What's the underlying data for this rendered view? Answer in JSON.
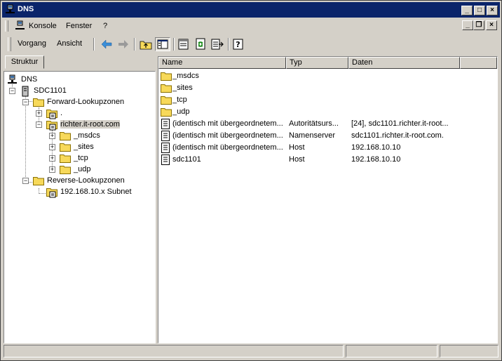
{
  "window": {
    "title": "DNS"
  },
  "menu": {
    "items": [
      "Konsole",
      "Fenster",
      "?"
    ]
  },
  "action_menu": {
    "items": [
      "Vorgang",
      "Ansicht"
    ]
  },
  "tab": {
    "label": "Struktur"
  },
  "tree": {
    "root": "DNS",
    "server": "SDC1101",
    "forward": "Forward-Lookupzonen",
    "dot_zone": ".",
    "zone": "richter.it-root.com",
    "children": [
      "_msdcs",
      "_sites",
      "_tcp",
      "_udp"
    ],
    "reverse": "Reverse-Lookupzonen",
    "subnet": "192.168.10.x Subnet"
  },
  "list": {
    "columns": [
      "Name",
      "Typ",
      "Daten"
    ],
    "rows": [
      {
        "icon": "folder",
        "name": "_msdcs",
        "type": "",
        "data": ""
      },
      {
        "icon": "folder",
        "name": "_sites",
        "type": "",
        "data": ""
      },
      {
        "icon": "folder",
        "name": "_tcp",
        "type": "",
        "data": ""
      },
      {
        "icon": "folder",
        "name": "_udp",
        "type": "",
        "data": ""
      },
      {
        "icon": "record",
        "name": "(identisch mit übergeordnetem...",
        "type": "Autoritätsurs...",
        "data": "[24], sdc1101.richter.it-root..."
      },
      {
        "icon": "record",
        "name": "(identisch mit übergeordnetem...",
        "type": "Namenserver",
        "data": "sdc1101.richter.it-root.com."
      },
      {
        "icon": "record",
        "name": "(identisch mit übergeordnetem...",
        "type": "Host",
        "data": "192.168.10.10"
      },
      {
        "icon": "record",
        "name": "sdc1101",
        "type": "Host",
        "data": "192.168.10.10"
      }
    ]
  },
  "colors": {
    "titlebar": "#0a246a",
    "chrome": "#d4d0c8",
    "folder": "#f7d95a"
  }
}
